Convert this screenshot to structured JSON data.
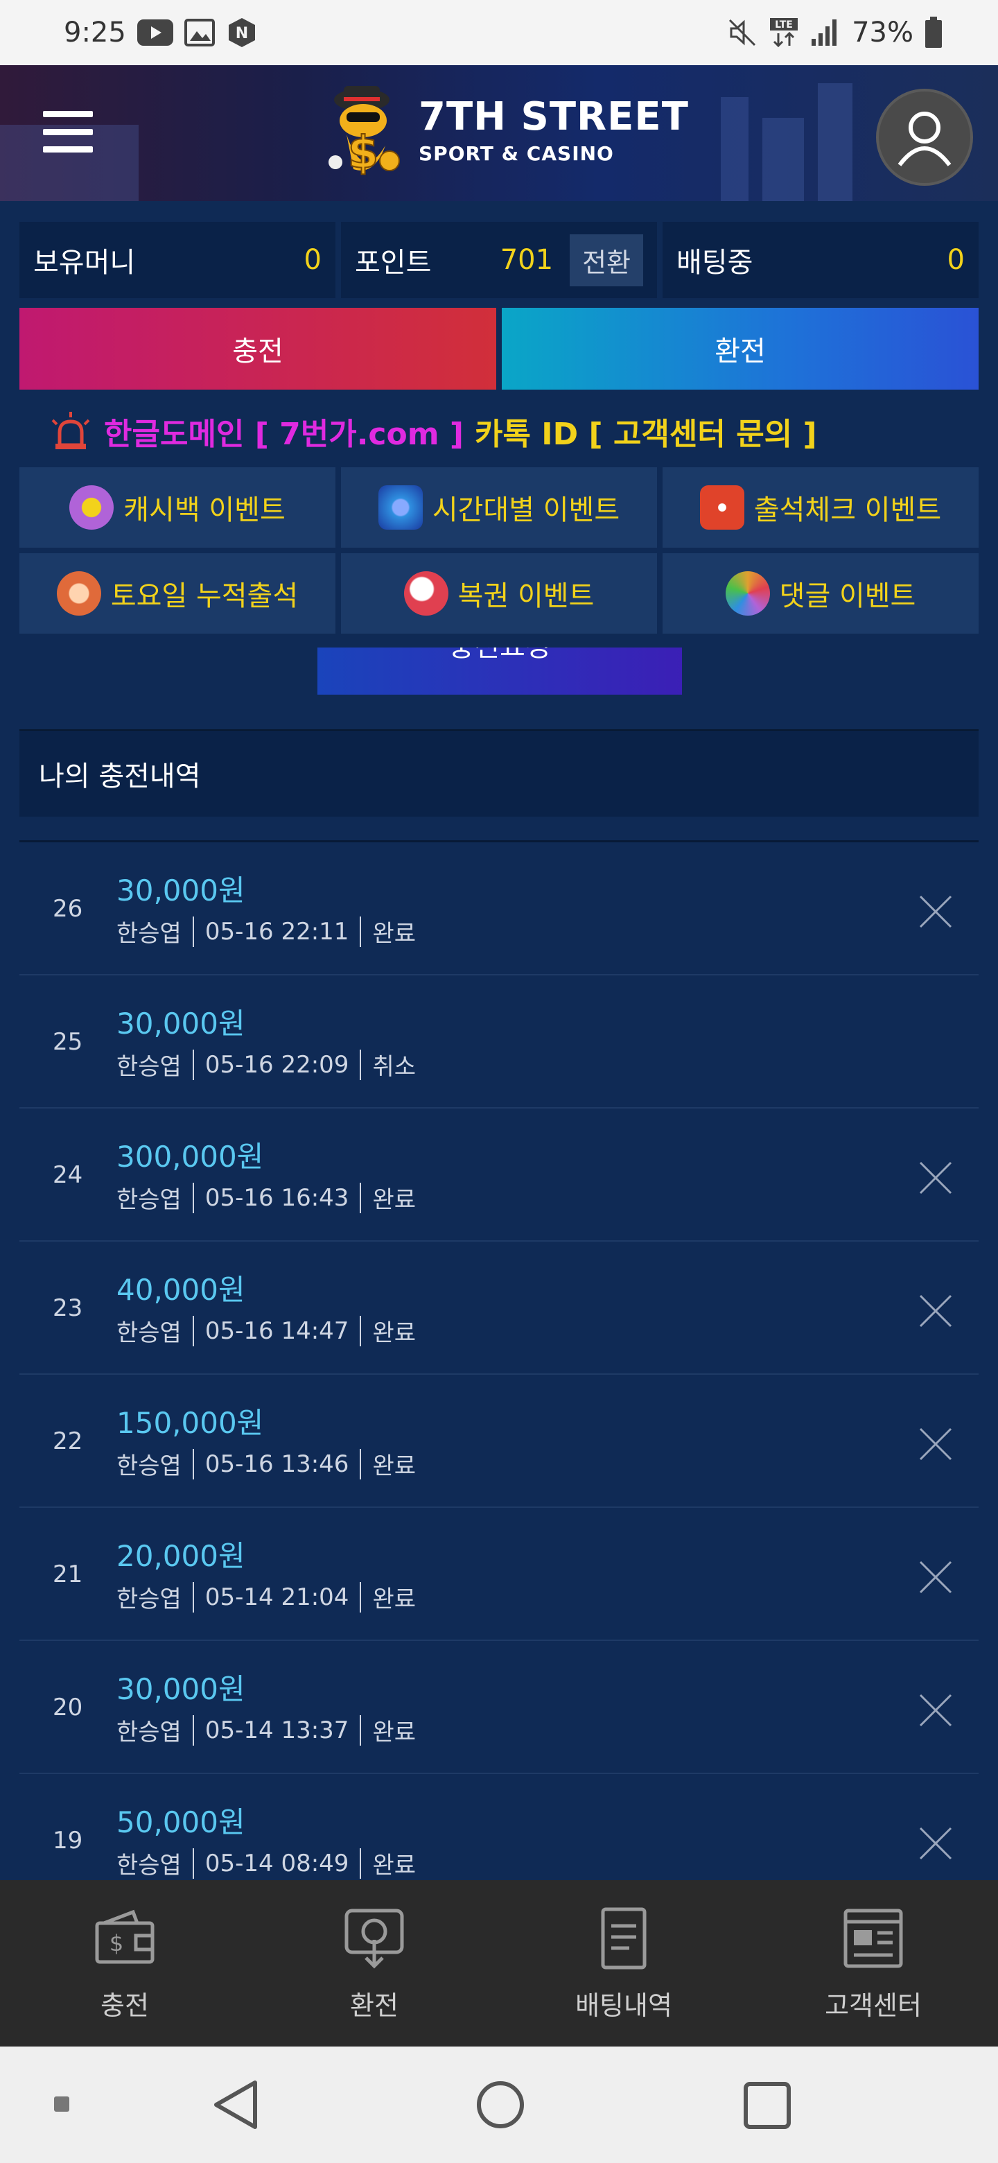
{
  "status_bar": {
    "time": "9:25",
    "battery": "73%"
  },
  "header": {
    "logo_title": "7TH STREET",
    "logo_subtitle": "SPORT & CASINO"
  },
  "balance": {
    "money_label": "보유머니",
    "money_value": "0",
    "point_label": "포인트",
    "point_value": "701",
    "convert_label": "전환",
    "betting_label": "배팅중",
    "betting_value": "0"
  },
  "actions": {
    "charge": "충전",
    "exchange": "환전"
  },
  "notice": {
    "part1": "한글도메인 [ 7번가.com ]",
    "part2": "카톡 ID [ 고객센터 문의 ]"
  },
  "events": [
    {
      "label": "캐시백 이벤트",
      "color": "#b063d8"
    },
    {
      "label": "시간대별 이벤트",
      "color": "#2f8fe0"
    },
    {
      "label": "출석체크 이벤트",
      "color": "#e0432a"
    },
    {
      "label": "토요일 누적출석",
      "color": "#e06a3a"
    },
    {
      "label": "복권 이벤트",
      "color": "#e04050"
    },
    {
      "label": "댓글 이벤트",
      "color": "#e0a030"
    }
  ],
  "partial_button": "충전요청",
  "history": {
    "title": "나의 충전내역",
    "rows": [
      {
        "num": "26",
        "amount": "30,000원",
        "name": "한승엽",
        "time": "05-16 22:11",
        "status": "완료",
        "closable": true
      },
      {
        "num": "25",
        "amount": "30,000원",
        "name": "한승엽",
        "time": "05-16 22:09",
        "status": "취소",
        "closable": false
      },
      {
        "num": "24",
        "amount": "300,000원",
        "name": "한승엽",
        "time": "05-16 16:43",
        "status": "완료",
        "closable": true
      },
      {
        "num": "23",
        "amount": "40,000원",
        "name": "한승엽",
        "time": "05-16 14:47",
        "status": "완료",
        "closable": true
      },
      {
        "num": "22",
        "amount": "150,000원",
        "name": "한승엽",
        "time": "05-16 13:46",
        "status": "완료",
        "closable": true
      },
      {
        "num": "21",
        "amount": "20,000원",
        "name": "한승엽",
        "time": "05-14 21:04",
        "status": "완료",
        "closable": true
      },
      {
        "num": "20",
        "amount": "30,000원",
        "name": "한승엽",
        "time": "05-14 13:37",
        "status": "완료",
        "closable": true
      },
      {
        "num": "19",
        "amount": "50,000원",
        "name": "한승엽",
        "time": "05-14 08:49",
        "status": "완료",
        "closable": true
      }
    ]
  },
  "tabbar": [
    {
      "label": "충전",
      "icon": "wallet-icon"
    },
    {
      "label": "환전",
      "icon": "withdraw-icon"
    },
    {
      "label": "배팅내역",
      "icon": "document-icon"
    },
    {
      "label": "고객센터",
      "icon": "news-icon"
    }
  ]
}
